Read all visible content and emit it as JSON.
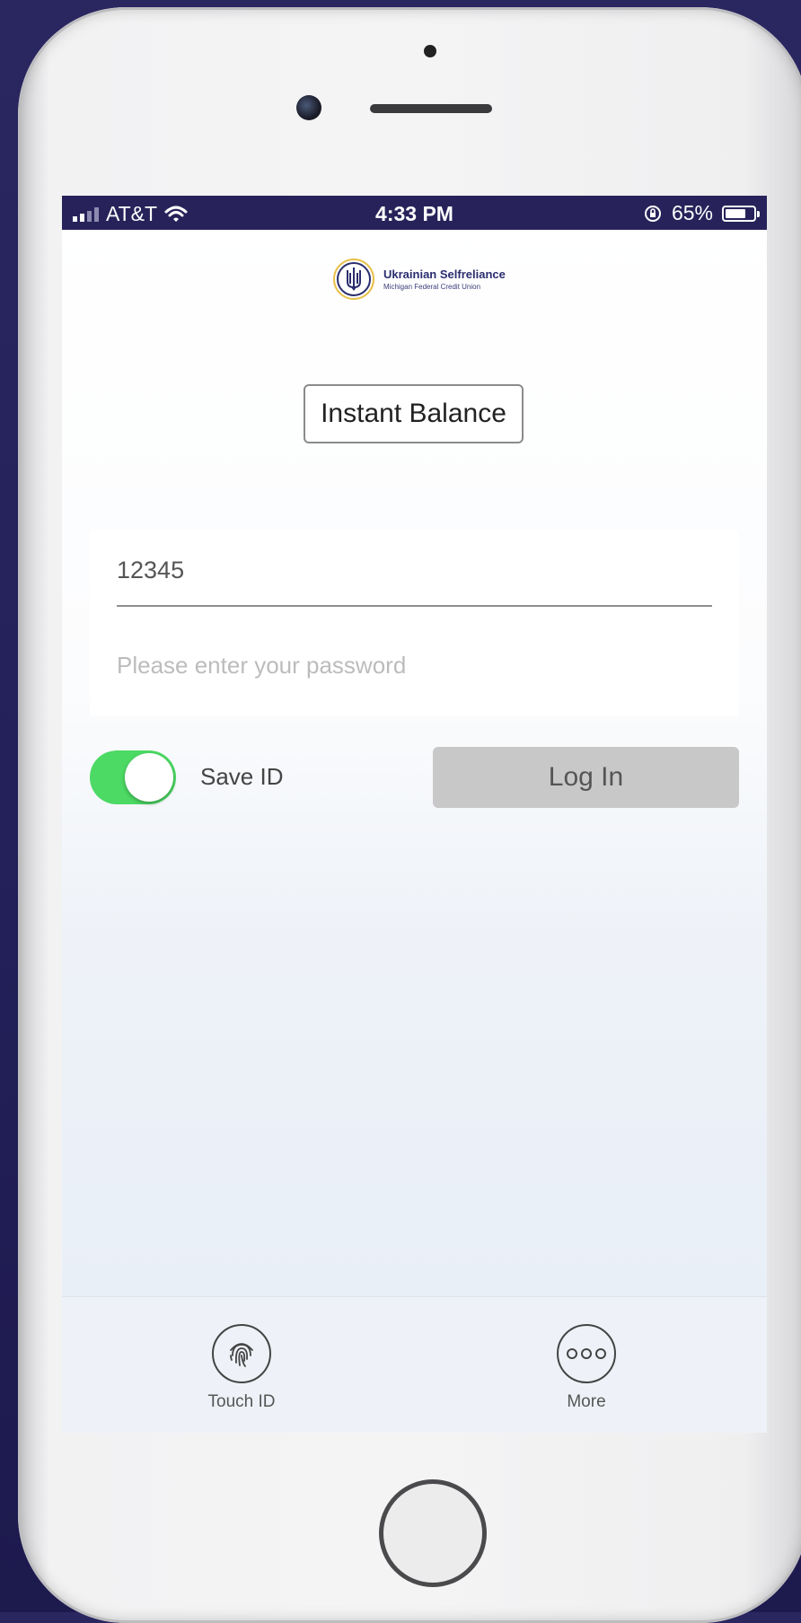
{
  "status_bar": {
    "carrier": "AT&T",
    "time": "4:33 PM",
    "battery_percent_label": "65%",
    "battery_level": 0.65,
    "icons": [
      "signal-icon",
      "wifi-icon",
      "orientation-lock-icon",
      "battery-icon"
    ]
  },
  "logo": {
    "name": "Ukrainian Selfreliance",
    "subtitle": "Michigan Federal Credit Union"
  },
  "instant_balance_label": "Instant Balance",
  "login_form": {
    "user_id_value": "12345",
    "password_placeholder": "Please enter your password"
  },
  "save_id": {
    "label": "Save ID",
    "enabled": true
  },
  "login_button_label": "Log In",
  "bottom_bar": {
    "items": [
      {
        "label": "Touch ID",
        "icon": "fingerprint-icon"
      },
      {
        "label": "More",
        "icon": "more-icon"
      }
    ]
  },
  "colors": {
    "status_bar_bg": "#27235a",
    "toggle_on": "#4cd964",
    "login_button_bg": "#c8c8c8",
    "logo_blue": "#2a2d6e",
    "logo_gold": "#e8c04a"
  }
}
